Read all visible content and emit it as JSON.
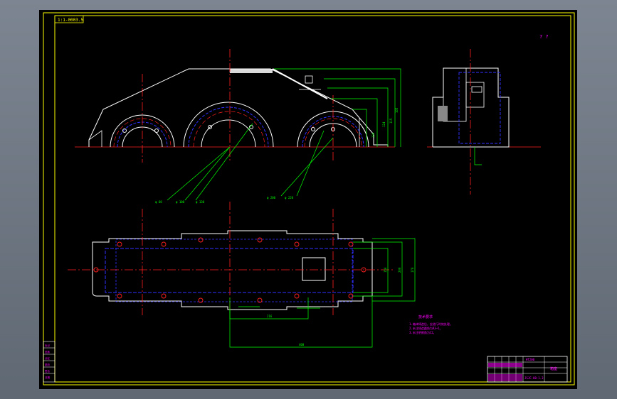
{
  "drawing": {
    "title_tag": "1:1-0003.5",
    "view_note": "? ?",
    "dimensions": {
      "front_heights": [
        "105",
        "115",
        "124",
        "130"
      ],
      "leaders": [
        "φ 68",
        "φ 100",
        "φ 130",
        "φ 200",
        "φ 220"
      ],
      "plan_width_inner": "150",
      "plan_width_outer": "200",
      "plan_spacing": "170",
      "plan_pitch": "216",
      "plan_total": "400"
    },
    "tech_requirements": {
      "heading": "技术要求",
      "lines": [
        "1.箱体铸造后，应进行时效处理。",
        "2.未注铸造圆角为R3~5。",
        "3.未注明倒角为C2。"
      ]
    },
    "title_block": {
      "material": "HT200",
      "part_name": "箱座",
      "drawing_no": "JSJC-00-1.3"
    },
    "revision_block": {
      "rows": [
        "标记",
        "处数",
        "分区",
        "更改",
        "签名",
        "日期"
      ]
    },
    "colors": {
      "frame": "#ffff00",
      "outline": "#ffffff",
      "centerline": "#ff2020",
      "hidden": "#3030ff",
      "dimension": "#00ff00",
      "annotation": "#ff00ff"
    }
  }
}
